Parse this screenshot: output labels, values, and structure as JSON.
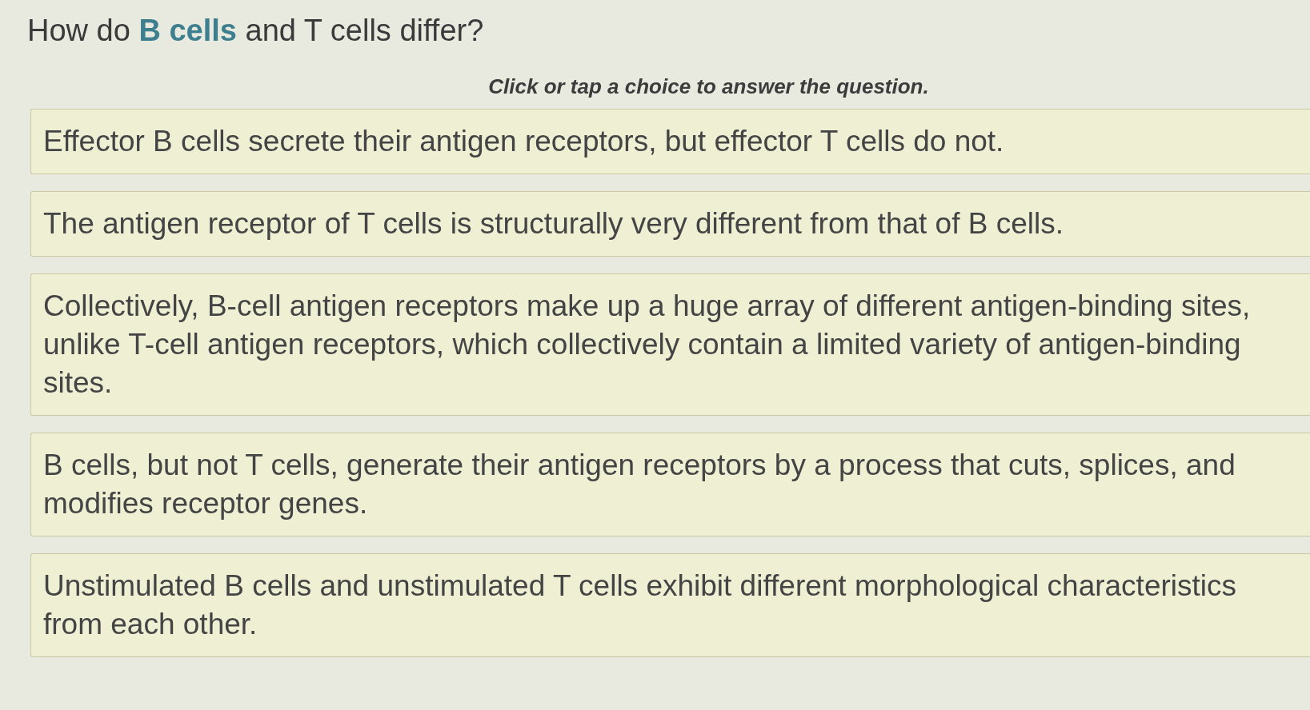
{
  "question": {
    "prompt": "How do **B cells** and T cells differ?",
    "instruction": "Click or tap a choice to answer the question."
  },
  "choices": [
    {
      "text": "Effector B cells secrete their antigen receptors, but effector T cells do not.",
      "selected": false
    },
    {
      "text": "The antigen receptor of T cells is structurally very different from that of B cells.",
      "selected": false
    },
    {
      "text": "Collectively, B-cell antigen receptors make up a huge array of different antigen-binding sites, unlike T-cell antigen receptors, which collectively contain a limited variety of antigen-binding sites.",
      "selected": false
    },
    {
      "text": "B cells, but not T cells, generate their antigen receptors by a process that cuts, splices, and modifies receptor genes.",
      "selected": false
    },
    {
      "text": "Unstimulated B cells and unstimulated T cells exhibit different morphological characteristics from each other.",
      "selected": false
    }
  ]
}
